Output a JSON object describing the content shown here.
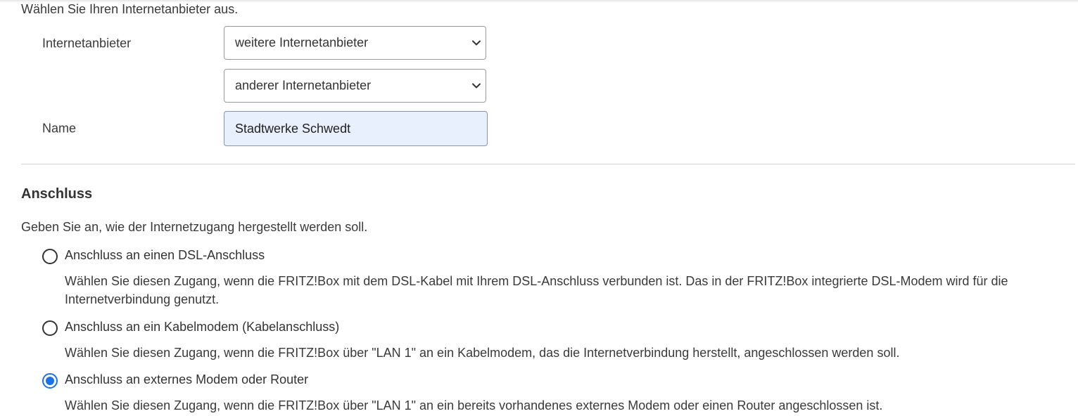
{
  "intro_text": "Wählen Sie Ihren Internetanbieter aus.",
  "provider": {
    "label": "Internetanbieter",
    "select1_value": "weitere Internetanbieter",
    "select2_value": "anderer Internetanbieter"
  },
  "name": {
    "label": "Name",
    "value": "Stadtwerke Schwedt"
  },
  "anschluss": {
    "title": "Anschluss",
    "description": "Geben Sie an, wie der Internetzugang hergestellt werden soll.",
    "options": [
      {
        "label": "Anschluss an einen DSL-Anschluss",
        "help": "Wählen Sie diesen Zugang, wenn die FRITZ!Box mit dem DSL-Kabel mit Ihrem DSL-Anschluss verbunden ist. Das in der FRITZ!Box integrierte DSL-Modem wird für die Internetverbindung genutzt.",
        "checked": false
      },
      {
        "label": "Anschluss an ein Kabelmodem (Kabelanschluss)",
        "help": "Wählen Sie diesen Zugang, wenn die FRITZ!Box über \"LAN 1\" an ein Kabelmodem, das die Internetverbindung herstellt, angeschlossen werden soll.",
        "checked": false
      },
      {
        "label": "Anschluss an externes Modem oder Router",
        "help": "Wählen Sie diesen Zugang, wenn die FRITZ!Box über \"LAN 1\" an ein bereits vorhandenes externes Modem oder einen Router angeschlossen ist.",
        "checked": true
      }
    ]
  },
  "colors": {
    "accent": "#1a73e8",
    "input_autofill_bg": "#e8f0fe",
    "divider": "#d4d4d4"
  },
  "icons": {
    "select_arrow": "chevron-down-icon",
    "radio_checked": "radio-checked-icon",
    "radio_unchecked": "radio-unchecked-icon"
  }
}
